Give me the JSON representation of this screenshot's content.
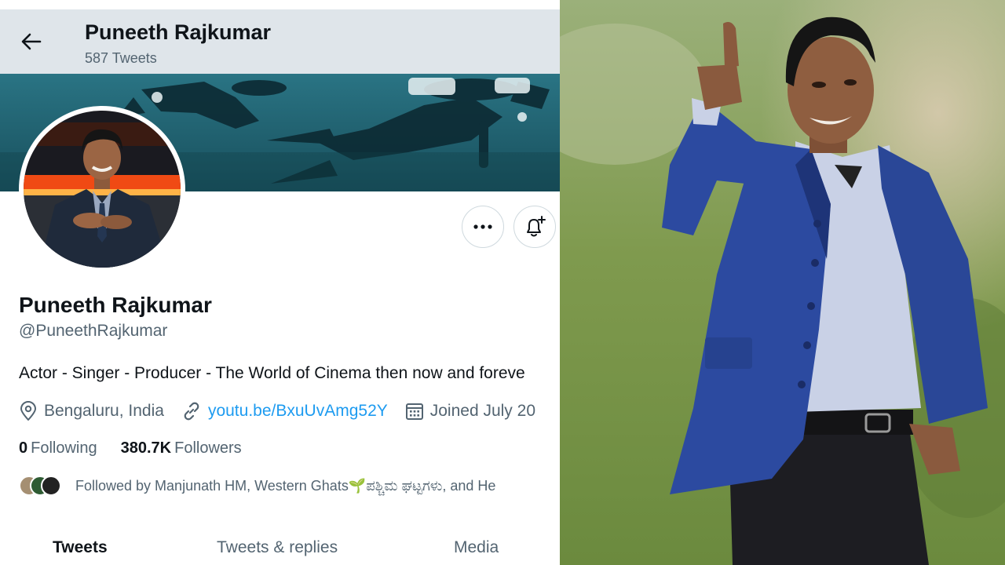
{
  "header": {
    "name": "Puneeth Rajkumar",
    "tweet_count": "587 Tweets",
    "back_icon": "arrow-left-icon"
  },
  "profile": {
    "display_name": "Puneeth Rajkumar",
    "handle": "@PuneethRajkumar",
    "bio": "Actor - Singer - Producer - The World of Cinema then now and foreve",
    "location": "Bengaluru, India",
    "link": "youtu.be/BxuUvAmg52Y",
    "joined": "Joined July 20",
    "following_count": "0",
    "following_label": "Following",
    "followers_count": "380.7K",
    "followers_label": "Followers",
    "followed_by": "Followed by Manjunath HM, Western Ghats🌱ಪಶ್ಚಿಮ ಘಟ್ಟಗಳು, and He"
  },
  "actions": {
    "more_icon": "more-horizontal-icon",
    "notify_icon": "bell-plus-icon"
  },
  "tabs": [
    {
      "label": "Tweets",
      "active": true
    },
    {
      "label": "Tweets & replies",
      "active": false
    },
    {
      "label": "Media",
      "active": false
    }
  ],
  "colors": {
    "link": "#1d9bf0",
    "secondary_text": "#536471",
    "header_bg": "#dfe5ea",
    "banner_bg": "#1e5f6e",
    "jacket": "#2c4aa0"
  }
}
